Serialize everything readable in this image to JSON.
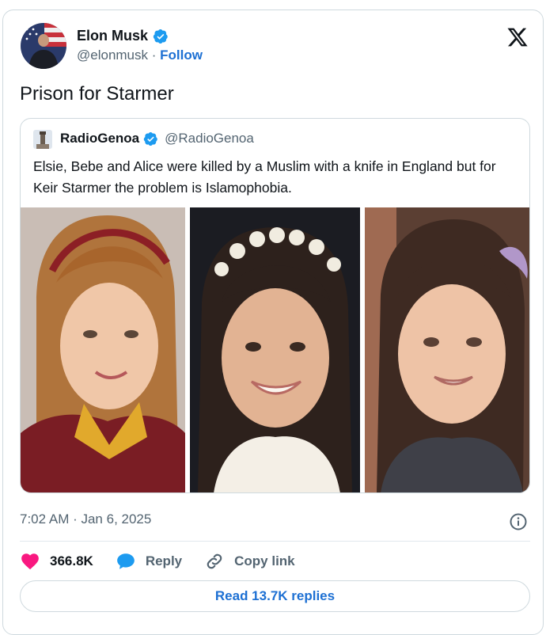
{
  "author": {
    "name": "Elon Musk",
    "handle": "@elonmusk",
    "separator": "·",
    "follow_label": "Follow",
    "verified_icon": "verified-badge-icon"
  },
  "tweet": {
    "text": "Prison for Starmer",
    "timestamp": "7:02 AM · Jan 6, 2025"
  },
  "quote": {
    "name": "RadioGenoa",
    "handle": "@RadioGenoa",
    "text": "Elsie, Bebe and Alice were killed by a Muslim with a knife in England but for Keir Starmer the problem is Islamophobia."
  },
  "actions": {
    "likes": "366.8K",
    "reply_label": "Reply",
    "copy_link_label": "Copy link",
    "read_replies_label": "Read 13.7K replies"
  },
  "colors": {
    "accent": "#1d70d3",
    "like": "#f91880",
    "verified": "#1d9bf0",
    "secondary_text": "#536471"
  }
}
